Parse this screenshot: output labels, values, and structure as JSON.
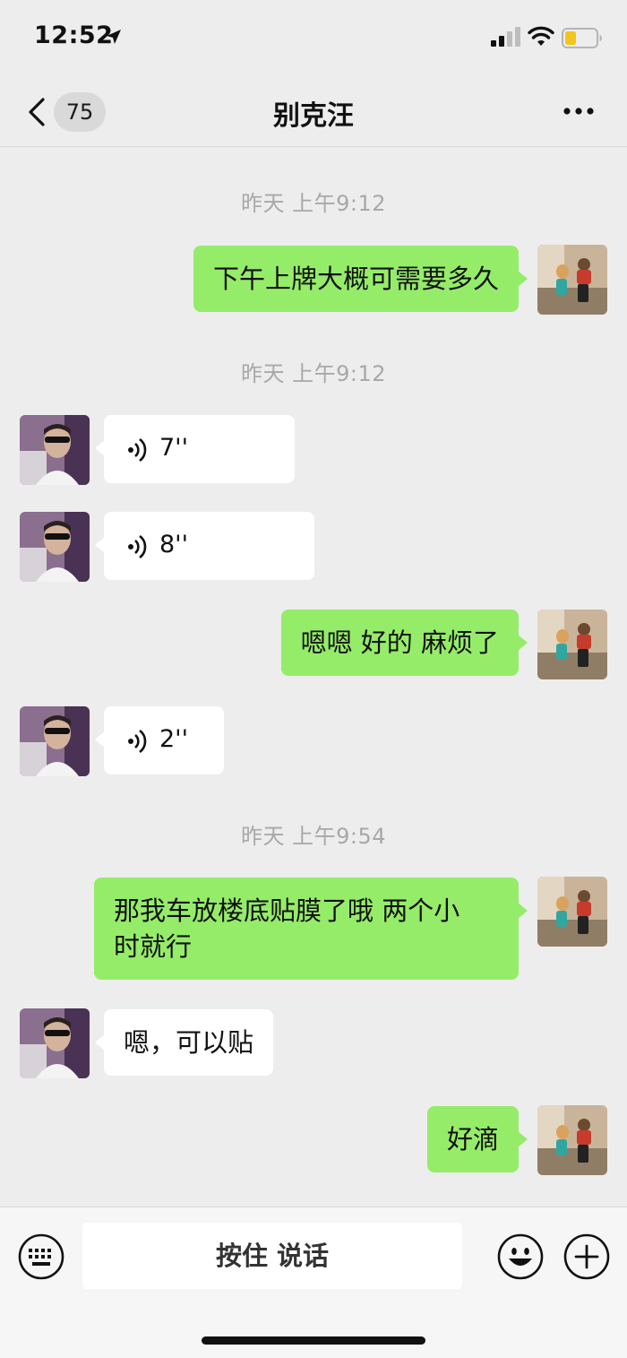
{
  "status_bar": {
    "time": "12:52"
  },
  "nav": {
    "unread_count": "75",
    "title": "别克汪"
  },
  "messages": [
    {
      "type": "timestamp",
      "text": "昨天 上午9:12"
    },
    {
      "type": "text",
      "side": "out",
      "lines": [
        "下午上牌大概可需要多久"
      ]
    },
    {
      "type": "timestamp",
      "text": "昨天 上午9:12"
    },
    {
      "type": "voice",
      "side": "in",
      "duration": "7''"
    },
    {
      "type": "voice",
      "side": "in",
      "duration": "8''"
    },
    {
      "type": "text",
      "side": "out",
      "lines": [
        "嗯嗯 好的 麻烦了"
      ]
    },
    {
      "type": "voice",
      "side": "in",
      "duration": "2''"
    },
    {
      "type": "timestamp",
      "text": "昨天 上午9:54"
    },
    {
      "type": "text",
      "side": "out",
      "lines": [
        "那我车放楼底贴膜了哦 两个小",
        "时就行"
      ]
    },
    {
      "type": "text",
      "side": "in",
      "lines": [
        "嗯，可以贴"
      ]
    },
    {
      "type": "text",
      "side": "out",
      "lines": [
        "好滴"
      ]
    }
  ],
  "input_bar": {
    "talk_label": "按住 说话"
  },
  "colors": {
    "outgoing_bubble": "#95ec69",
    "incoming_bubble": "#ffffff",
    "background": "#ededed"
  },
  "icons": [
    "location-arrow-icon",
    "signal-icon",
    "wifi-icon",
    "battery-icon",
    "back-chevron-icon",
    "more-dots-icon",
    "voice-wave-icon",
    "keyboard-icon",
    "emoji-icon",
    "plus-icon"
  ]
}
